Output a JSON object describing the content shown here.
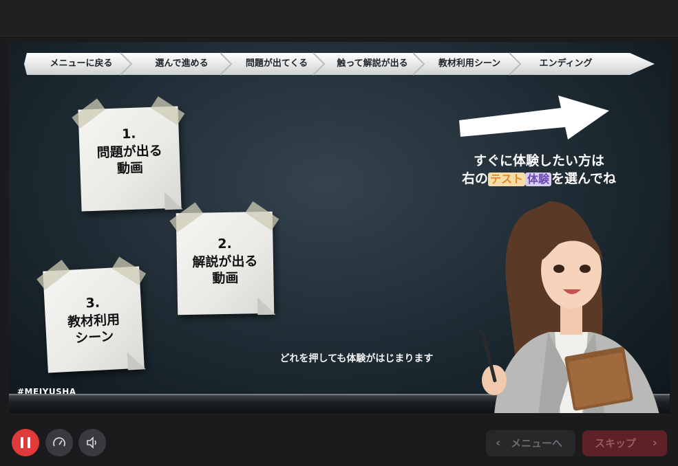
{
  "progress_steps": [
    "メニューに戻る",
    "選んで進める",
    "問題が出てくる",
    "触って解説が出る",
    "教材利用シーン",
    "エンディング"
  ],
  "notes": [
    {
      "number": "1.",
      "line1": "問題が出る",
      "line2": "動画"
    },
    {
      "number": "2.",
      "line1": "解説が出る",
      "line2": "動画"
    },
    {
      "number": "3.",
      "line1": "教材利用",
      "line2": "シーン"
    }
  ],
  "cta": {
    "line1": "すぐに体験したい方は",
    "prefix": "右の",
    "tag_test": "テスト",
    "tag_experience": "体験",
    "suffix": "を選んでね"
  },
  "bottom_caption": "どれを押しても体験がはじまります",
  "hashtag": "#MEIYUSHA",
  "controls": {
    "pause_icon": "pause-icon",
    "speed_icon": "speedometer-icon",
    "volume_icon": "speaker-icon",
    "menu_label": "メニューへ",
    "skip_label": "スキップ"
  },
  "colors": {
    "accent_red": "#e13a3a",
    "skip_bg": "#5e2126",
    "tag_test": "#e0892b",
    "tag_experience": "#6c4bb4"
  }
}
